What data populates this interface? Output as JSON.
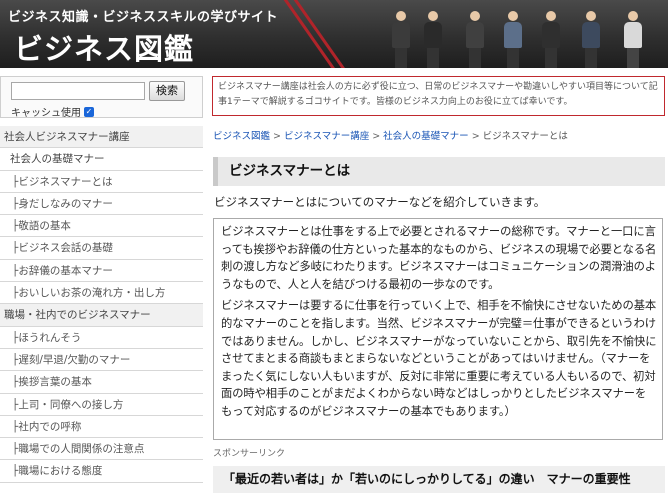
{
  "header": {
    "tagline": "ビジネス知識・ビジネススキルの学びサイト",
    "logo": "ビジネス図鑑"
  },
  "sidebar": {
    "search_button": "検索",
    "cache_label": "キャッシュ使用",
    "cache_checked": true,
    "menu": [
      {
        "kind": "cat",
        "label": "社会人ビジネスマナー講座"
      },
      {
        "kind": "sub",
        "label": "社会人の基礎マナー"
      },
      {
        "kind": "leaf",
        "label": "├ビジネスマナーとは"
      },
      {
        "kind": "leaf",
        "label": "├身だしなみのマナー"
      },
      {
        "kind": "leaf",
        "label": "├敬語の基本"
      },
      {
        "kind": "leaf",
        "label": "├ビジネス会話の基礎"
      },
      {
        "kind": "leaf",
        "label": "├お辞儀の基本マナー"
      },
      {
        "kind": "leaf",
        "label": "├おいしいお茶の淹れ方・出し方"
      },
      {
        "kind": "cat",
        "label": "職場・社内でのビジネスマナー"
      },
      {
        "kind": "leaf",
        "label": "├ほうれんそう"
      },
      {
        "kind": "leaf",
        "label": "├遅刻/早退/欠勤のマナー"
      },
      {
        "kind": "leaf",
        "label": "├挨拶言葉の基本"
      },
      {
        "kind": "leaf",
        "label": "├上司・同僚への接し方"
      },
      {
        "kind": "leaf",
        "label": "├社内での呼称"
      },
      {
        "kind": "leaf",
        "label": "├職場での人間関係の注意点"
      },
      {
        "kind": "leaf",
        "label": "├職場における態度"
      }
    ]
  },
  "main": {
    "notice": "ビジネスマナー講座は社会人の方に必ず役に立つ、日常のビジネスマナーや勘違いしやすい項目等について記事1テーマで解説するゴコサイトです。皆様のビジネス力向上のお役に立てば幸いです。",
    "breadcrumb": [
      {
        "label": "ビジネス図鑑",
        "link": true
      },
      {
        "label": "ビジネスマナー講座",
        "link": true
      },
      {
        "label": "社会人の基礎マナー",
        "link": true
      },
      {
        "label": "ビジネスマナーとは",
        "link": false
      }
    ],
    "breadcrumb_sep": ">",
    "title": "ビジネスマナーとは",
    "intro": "ビジネスマナーとはについてのマナーなどを紹介していきます。",
    "paragraphs": [
      "ビジネスマナーとは仕事をする上で必要とされるマナーの総称です。マナーと一口に言っても挨拶やお辞儀の仕方といった基本的なものから、ビジネスの現場で必要となる名刺の渡し方など多岐にわたります。ビジネスマナーはコミュニケーションの潤滑油のようなもので、人と人を結びつける最初の一歩なのです。",
      "ビジネスマナーは要するに仕事を行っていく上で、相手を不愉快にさせないための基本的なマナーのことを指します。当然、ビジネスマナーが完璧＝仕事ができるというわけではありません。しかし、ビジネスマナーがなっていないことから、取引先を不愉快にさせてまとまる商談もまとまらないなどということがあってはいけません。（マナーをまったく気にしない人もいますが、反対に非常に重要に考えている人もいるので、初対面の時や相手のことがまだよくわからない時などはしっかりとしたビジネスマナーをもって対応するのがビジネスマナーの基本でもあります。）"
    ],
    "sponsor": "スポンサーリンク",
    "bottom_heading": "「最近の若い者は」か「若いのにしっかりしてる」の違い　マナーの重要性"
  }
}
